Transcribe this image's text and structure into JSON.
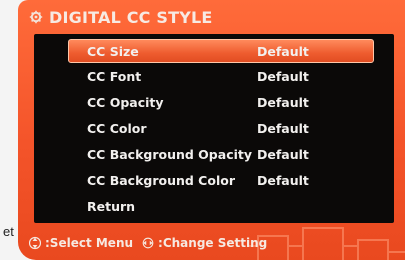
{
  "edge_text": "et",
  "header": {
    "title": "DIGITAL CC STYLE",
    "icon": "settings-icon"
  },
  "menu": {
    "items": [
      {
        "label": "CC Size",
        "value": "Default",
        "selected": true
      },
      {
        "label": "CC Font",
        "value": "Default"
      },
      {
        "label": "CC Opacity",
        "value": "Default"
      },
      {
        "label": "CC Color",
        "value": "Default"
      },
      {
        "label": "CC Background Opacity",
        "value": "Default"
      },
      {
        "label": "CC Background Color",
        "value": "Default"
      },
      {
        "label": "Return",
        "value": ""
      }
    ]
  },
  "footer": {
    "select_hint": ":Select Menu",
    "change_hint": ":Change Setting",
    "select_icon": "up-down-arrows-icon",
    "change_icon": "left-right-arrows-icon"
  },
  "colors": {
    "screen": "#f4542a",
    "panel": "#0b0908",
    "highlight": "#ee5c2f"
  }
}
